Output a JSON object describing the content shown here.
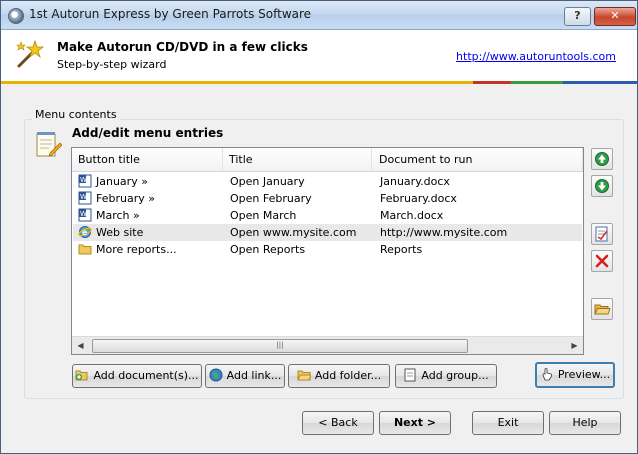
{
  "window": {
    "title": "1st Autorun Express by Green Parrots Software",
    "help_label": "?",
    "close_label": "✕"
  },
  "header": {
    "title": "Make Autorun CD/DVD in a few clicks",
    "subtitle": "Step-by-step wizard",
    "link": "http://www.autoruntools.com",
    "accent_colors": [
      "#e8b200",
      "#c33526",
      "#3a9c3a",
      "#2a5db0"
    ]
  },
  "group": {
    "label": "Menu contents",
    "section_title": "Add/edit menu entries"
  },
  "list": {
    "columns": [
      "Button title",
      "Title",
      "Document to run"
    ],
    "rows": [
      {
        "icon": "word-doc-icon",
        "button_title": "January »",
        "title": "Open January",
        "document": "January.docx",
        "selected": false
      },
      {
        "icon": "word-doc-icon",
        "button_title": "February »",
        "title": "Open February",
        "document": "February.docx",
        "selected": false
      },
      {
        "icon": "word-doc-icon",
        "button_title": "March »",
        "title": "Open March",
        "document": "March.docx",
        "selected": false
      },
      {
        "icon": "ie-globe-icon",
        "button_title": "Web site",
        "title": "Open www.mysite.com",
        "document": "http://www.mysite.com",
        "selected": true
      },
      {
        "icon": "folder-icon",
        "button_title": "More reports...",
        "title": "Open Reports",
        "document": "Reports",
        "selected": false
      }
    ]
  },
  "actions": {
    "add_document": "Add document(s)...",
    "add_link": "Add link...",
    "add_folder": "Add folder...",
    "add_group": "Add group...",
    "preview": "Preview..."
  },
  "nav": {
    "back": "< Back",
    "next": "Next >",
    "exit": "Exit",
    "help": "Help"
  }
}
